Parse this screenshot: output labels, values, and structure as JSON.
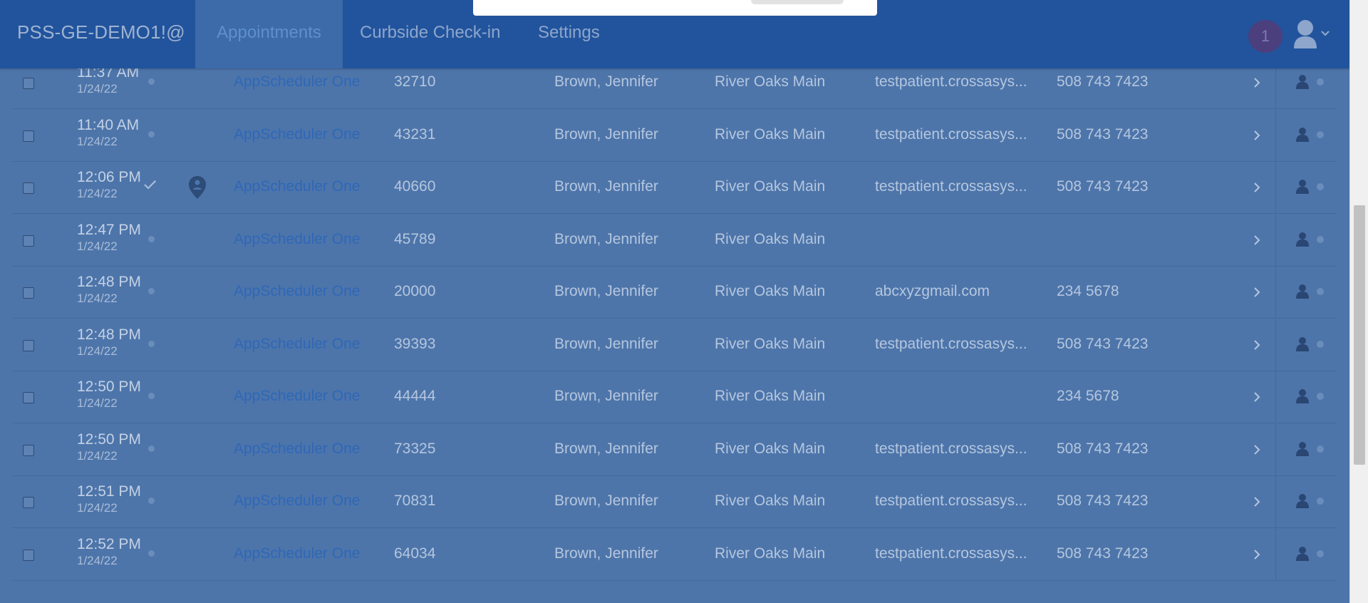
{
  "app": {
    "brand": "PSS-GE-DEMO1!@",
    "nav_tabs": [
      {
        "label": "Appointments",
        "active": true
      },
      {
        "label": "Curbside Check-in",
        "active": false
      },
      {
        "label": "Settings",
        "active": false
      }
    ],
    "notification_count": "1",
    "user_icon": "user-icon"
  },
  "colors": {
    "navbar": "#22549d",
    "overlay_bg": "#4d75aa",
    "provider_link": "#2f67b7",
    "notification_badge": "#4b3f7e"
  },
  "rows": [
    {
      "time": "11:37 AM",
      "date": "1/24/22",
      "status": "dot",
      "curbside_pin": false,
      "provider": "AppScheduler One",
      "mrn": "32710",
      "patient": "Brown, Jennifer",
      "location": "River Oaks Main",
      "email": "testpatient.crossasys...",
      "phone": "508 743 7423"
    },
    {
      "time": "11:40 AM",
      "date": "1/24/22",
      "status": "dot",
      "curbside_pin": false,
      "provider": "AppScheduler One",
      "mrn": "43231",
      "patient": "Brown, Jennifer",
      "location": "River Oaks Main",
      "email": "testpatient.crossasys...",
      "phone": "508 743 7423"
    },
    {
      "time": "12:06 PM",
      "date": "1/24/22",
      "status": "check",
      "curbside_pin": true,
      "provider": "AppScheduler One",
      "mrn": "40660",
      "patient": "Brown, Jennifer",
      "location": "River Oaks Main",
      "email": "testpatient.crossasys...",
      "phone": "508 743 7423"
    },
    {
      "time": "12:47 PM",
      "date": "1/24/22",
      "status": "dot",
      "curbside_pin": false,
      "provider": "AppScheduler One",
      "mrn": "45789",
      "patient": "Brown, Jennifer",
      "location": "River Oaks Main",
      "email": "",
      "phone": ""
    },
    {
      "time": "12:48 PM",
      "date": "1/24/22",
      "status": "dot",
      "curbside_pin": false,
      "provider": "AppScheduler One",
      "mrn": "20000",
      "patient": "Brown, Jennifer",
      "location": "River Oaks Main",
      "email": "abcxyzgmail.com",
      "phone": "234 5678"
    },
    {
      "time": "12:48 PM",
      "date": "1/24/22",
      "status": "dot",
      "curbside_pin": false,
      "provider": "AppScheduler One",
      "mrn": "39393",
      "patient": "Brown, Jennifer",
      "location": "River Oaks Main",
      "email": "testpatient.crossasys...",
      "phone": "508 743 7423"
    },
    {
      "time": "12:50 PM",
      "date": "1/24/22",
      "status": "dot",
      "curbside_pin": false,
      "provider": "AppScheduler One",
      "mrn": "44444",
      "patient": "Brown, Jennifer",
      "location": "River Oaks Main",
      "email": "",
      "phone": "234 5678"
    },
    {
      "time": "12:50 PM",
      "date": "1/24/22",
      "status": "dot",
      "curbside_pin": false,
      "provider": "AppScheduler One",
      "mrn": "73325",
      "patient": "Brown, Jennifer",
      "location": "River Oaks Main",
      "email": "testpatient.crossasys...",
      "phone": "508 743 7423"
    },
    {
      "time": "12:51 PM",
      "date": "1/24/22",
      "status": "dot",
      "curbside_pin": false,
      "provider": "AppScheduler One",
      "mrn": "70831",
      "patient": "Brown, Jennifer",
      "location": "River Oaks Main",
      "email": "testpatient.crossasys...",
      "phone": "508 743 7423"
    },
    {
      "time": "12:52 PM",
      "date": "1/24/22",
      "status": "dot",
      "curbside_pin": false,
      "provider": "AppScheduler One",
      "mrn": "64034",
      "patient": "Brown, Jennifer",
      "location": "River Oaks Main",
      "email": "testpatient.crossasys...",
      "phone": "508 743 7423"
    }
  ]
}
